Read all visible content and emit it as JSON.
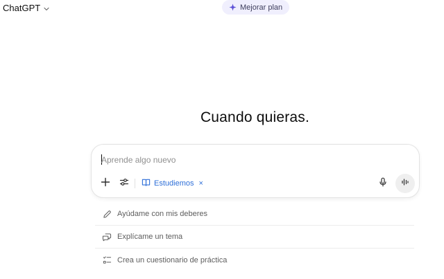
{
  "header": {
    "model_name": "ChatGPT",
    "upgrade_label": "Mejorar plan"
  },
  "main": {
    "headline": "Cuando quieras."
  },
  "composer": {
    "placeholder": "Aprende algo nuevo",
    "study_chip_label": "Estudiemos",
    "study_chip_remove": "×",
    "icons": {
      "add": "plus-icon",
      "tools": "sliders-icon",
      "study": "book-icon",
      "mic": "microphone-icon",
      "voice": "voice-waveform-icon"
    }
  },
  "suggestions": [
    {
      "label": "Ayúdame con mis deberes",
      "icon": "pencil-icon"
    },
    {
      "label": "Explícame un tema",
      "icon": "chat-bubbles-icon"
    },
    {
      "label": "Crea un cuestionario de práctica",
      "icon": "checklist-icon"
    }
  ],
  "colors": {
    "accent_blue": "#2e6fd8",
    "upgrade_bg": "#f0effd"
  }
}
